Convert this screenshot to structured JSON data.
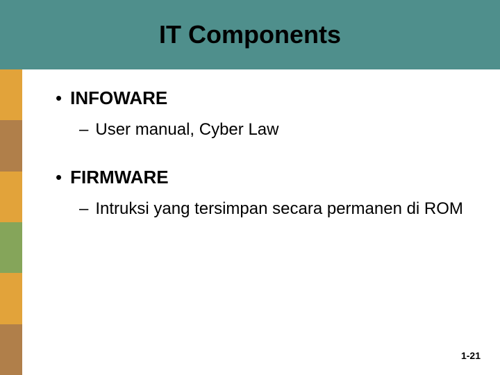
{
  "title": "IT Components",
  "sidebar_colors": [
    "#e2a33a",
    "#b07f4a",
    "#e2a33a",
    "#85a55a",
    "#e2a33a",
    "#b07f4a"
  ],
  "items": [
    {
      "label": "INFOWARE",
      "sub": "User manual, Cyber Law"
    },
    {
      "label": "FIRMWARE",
      "sub": "Intruksi yang tersimpan secara permanen di ROM"
    }
  ],
  "footer": "1-21"
}
